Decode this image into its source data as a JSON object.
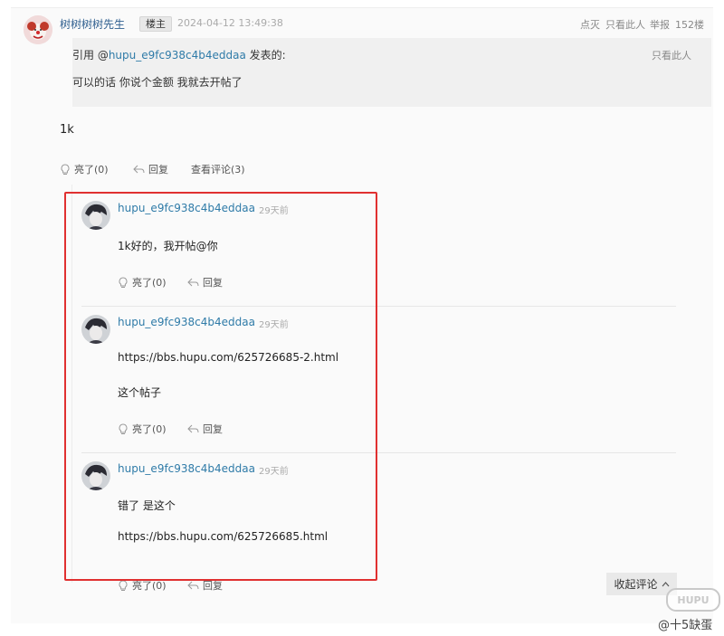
{
  "post": {
    "author": "树树树树先生",
    "badge": "楼主",
    "timestamp": "2024-04-12 13:49:38",
    "tools": {
      "light": "点灭",
      "only_this": "只看此人",
      "report": "举报",
      "floor": "152楼"
    },
    "quote": {
      "prefix": "引用 @",
      "user": "hupu_e9fc938c4b4eddaa",
      "suffix": " 发表的:",
      "only_this": "只看此人",
      "text": "可以的话 你说个金额 我就去开帖了"
    },
    "content": "1k",
    "actions": {
      "light": "亮了(0)",
      "reply": "回复",
      "view_comments": "查看评论(3)"
    }
  },
  "comments": [
    {
      "user": "hupu_e9fc938c4b4eddaa",
      "time": "29天前",
      "lines": [
        "1k好的，我开帖@你"
      ],
      "light": "亮了(0)",
      "reply": "回复"
    },
    {
      "user": "hupu_e9fc938c4b4eddaa",
      "time": "29天前",
      "link": "https://bbs.hupu.com/625726685-2.html",
      "lines": [
        "这个帖子"
      ],
      "light": "亮了(0)",
      "reply": "回复"
    },
    {
      "user": "hupu_e9fc938c4b4eddaa",
      "time": "29天前",
      "lines": [
        "错了 是这个"
      ],
      "link": "https://bbs.hupu.com/625726685.html",
      "light": "亮了(0)",
      "reply": "回复"
    }
  ],
  "collapse_label": "收起评论",
  "watermark": {
    "logo": "HUPU",
    "author": "@十5缺蛋"
  },
  "colors": {
    "highlight_border": "#e03030",
    "link": "#2f7ba8"
  }
}
